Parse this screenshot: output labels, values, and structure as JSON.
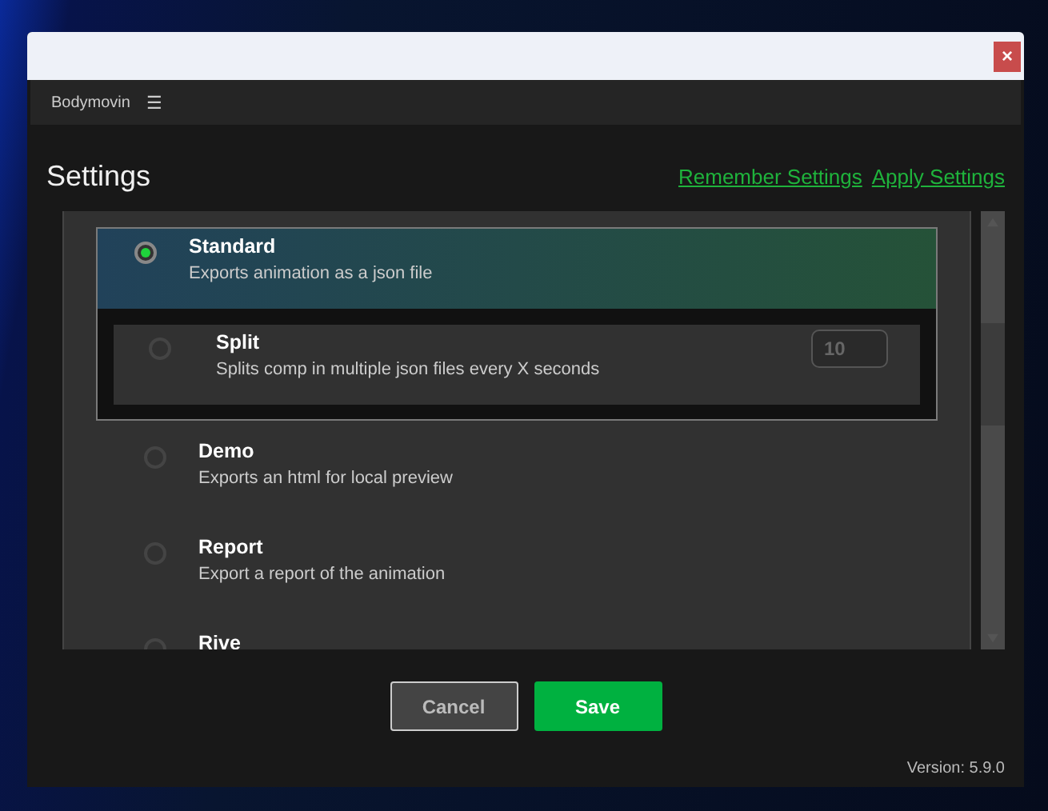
{
  "window": {
    "close_label": "×"
  },
  "menu_bar": {
    "title": "Bodymovin",
    "menu_icon": "☰"
  },
  "header": {
    "title": "Settings",
    "links": [
      "Remember Settings",
      "Apply Settings"
    ]
  },
  "options": [
    {
      "title": "Standard",
      "description": "Exports animation as a json file",
      "selected": true,
      "children": [
        {
          "title": "Split",
          "description": "Splits comp in multiple json files every X seconds",
          "selected": false,
          "placeholder": "10"
        }
      ]
    },
    {
      "title": "Demo",
      "description": "Exports an html for local preview",
      "selected": false
    },
    {
      "title": "Report",
      "description": "Export a report of the animation",
      "selected": false
    },
    {
      "title": "Rive",
      "selected": false
    }
  ],
  "buttons": [
    {
      "label": "Cancel",
      "kind": "secondary"
    },
    {
      "label": "Save",
      "kind": "primary"
    }
  ],
  "version": "Version: 5.9.0"
}
